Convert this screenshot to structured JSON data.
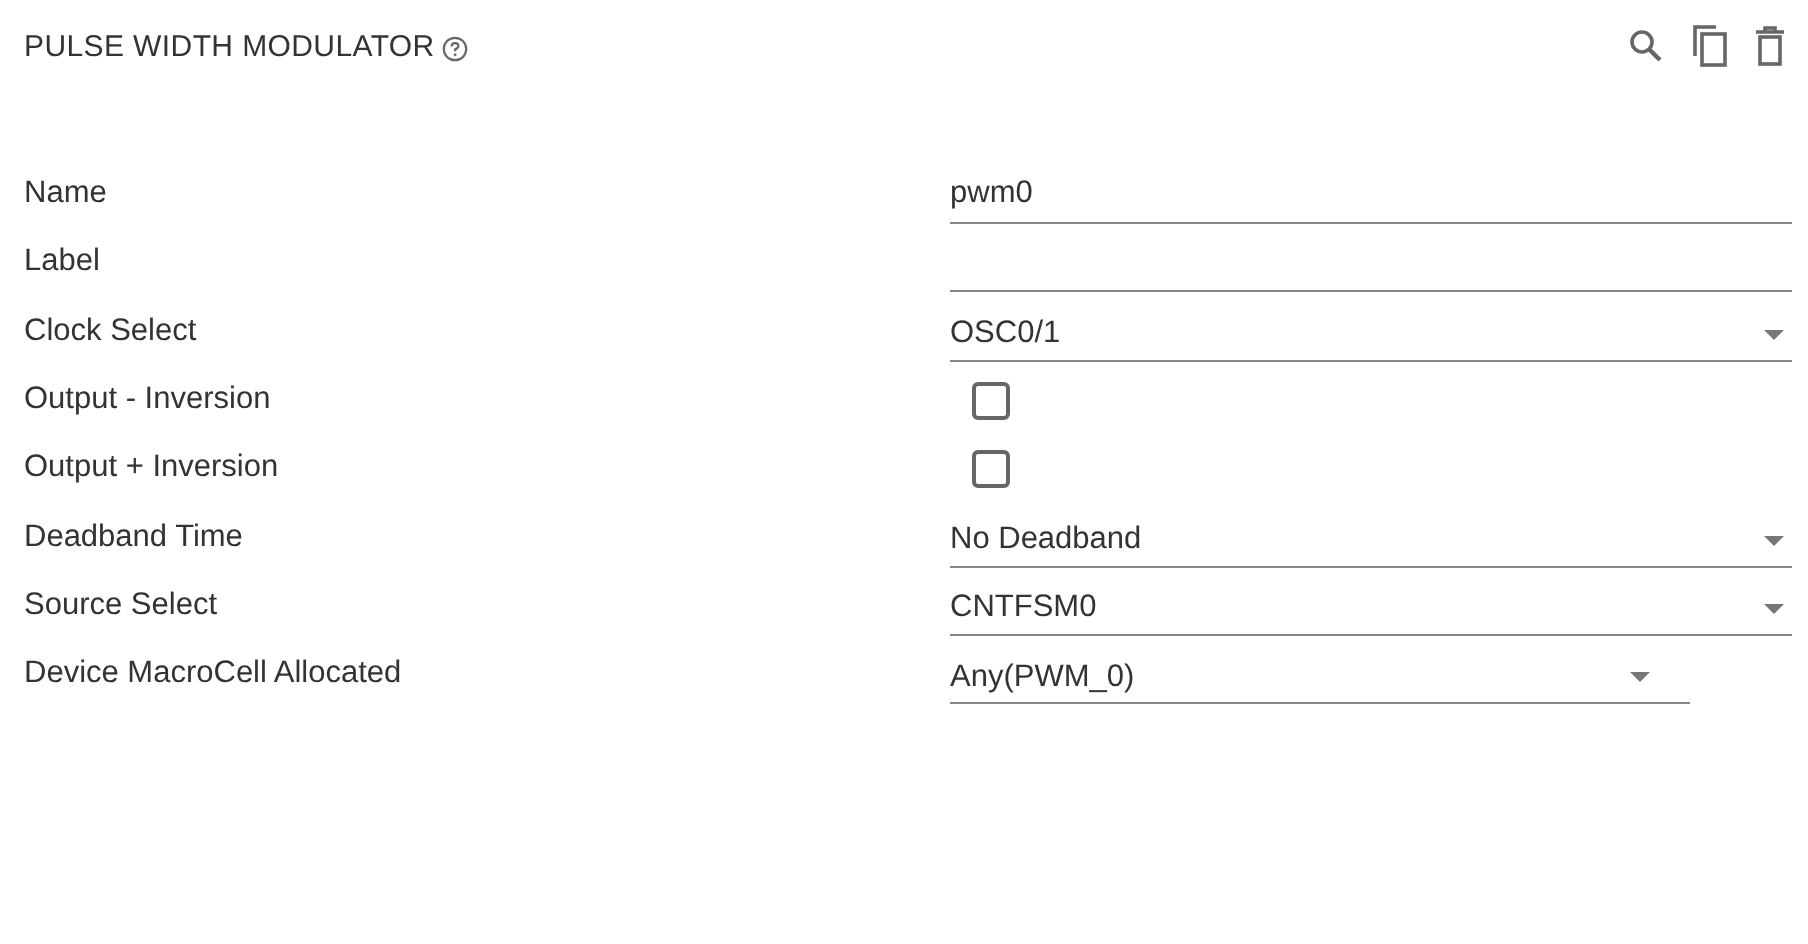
{
  "panel": {
    "title": "PULSE WIDTH MODULATOR"
  },
  "fields": [
    {
      "label": "Name",
      "kind": "text",
      "value": "pwm0"
    },
    {
      "label": "Label",
      "kind": "text"
    },
    {
      "label": "Clock Select",
      "kind": "select",
      "value": "OSC0/1",
      "compact": false
    },
    {
      "label": "Output - Inversion",
      "kind": "checkbox",
      "checked": false
    },
    {
      "label": "Output + Inversion",
      "kind": "checkbox",
      "checked": false
    },
    {
      "label": "Deadband Time",
      "kind": "select",
      "value": "No Deadband",
      "compact": false
    },
    {
      "label": "Source Select",
      "kind": "select",
      "value": "CNTFSM0",
      "compact": false
    },
    {
      "label": "Device MacroCell Allocated",
      "kind": "select",
      "value": "Any(PWM_0)",
      "compact": true
    }
  ]
}
